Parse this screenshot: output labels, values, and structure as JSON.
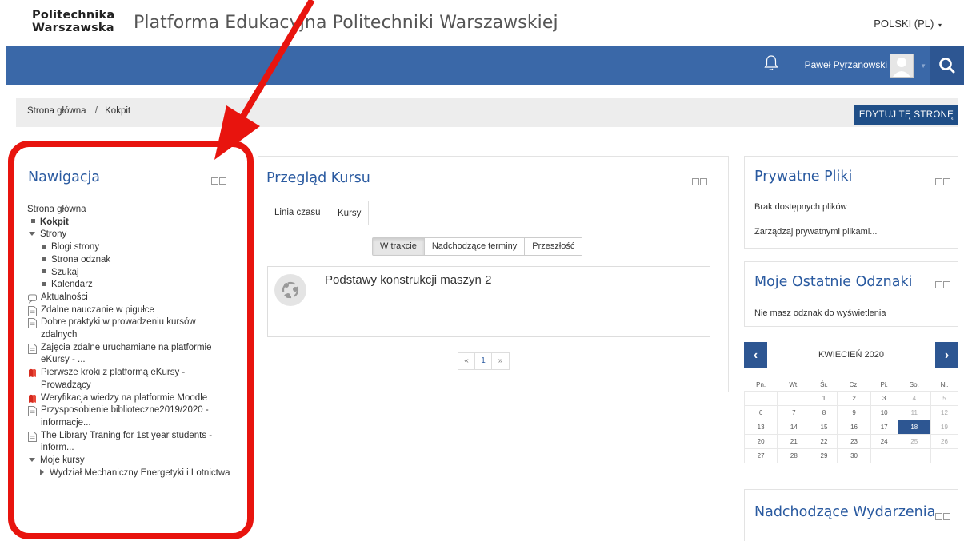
{
  "header": {
    "logo_line1": "Politechnika",
    "logo_line2": "Warszawska",
    "site_title": "Platforma Edukacyjna Politechniki Warszawskiej",
    "language": "POLSKI (PL)"
  },
  "navbar": {
    "user_name": "Paweł Pyrzanowski"
  },
  "breadcrumb": {
    "home": "Strona główna",
    "separator": "/",
    "current": "Kokpit",
    "edit_button": "EDYTUJ TĘ STRONĘ"
  },
  "navigation": {
    "title": "Nawigacja",
    "home": "Strona główna",
    "kokpit": "Kokpit",
    "strony": "Strony",
    "strony_items": [
      "Blogi strony",
      "Strona odznak",
      "Szukaj",
      "Kalendarz"
    ],
    "aktualnosci": "Aktualności",
    "docs": [
      {
        "line1": "Zdalne nauczanie w pigułce",
        "line2": "",
        "icon": "document-icon"
      },
      {
        "line1": "Dobre praktyki w prowadzeniu kursów",
        "line2": "zdalnych",
        "icon": "document-icon"
      },
      {
        "line1": "Zajęcia zdalne uruchamiane na platformie",
        "line2": "eKursy - ...",
        "icon": "document-icon"
      },
      {
        "line1": "Pierwsze kroki z platformą eKursy -",
        "line2": "Prowadzący",
        "icon": "pdf-icon"
      },
      {
        "line1": "Weryfikacja wiedzy na platformie Moodle",
        "line2": "",
        "icon": "pdf-icon"
      },
      {
        "line1": "Przysposobienie biblioteczne2019/2020 -",
        "line2": "informacje...",
        "icon": "document-icon"
      },
      {
        "line1": "The Library Traning for 1st year students -",
        "line2": "inform...",
        "icon": "document-icon"
      }
    ],
    "moje_kursy": "Moje kursy",
    "faculty": "Wydział Mechaniczny Energetyki i Lotnictwa"
  },
  "course_overview": {
    "title": "Przegląd Kursu",
    "tabs": [
      "Linia czasu",
      "Kursy"
    ],
    "active_tab": "Kursy",
    "filters": [
      "W trakcie",
      "Nadchodzące terminy",
      "Przeszłość"
    ],
    "active_filter": "W trakcie",
    "course_name": "Podstawy konstrukcji maszyn 2",
    "pager": {
      "prev": "«",
      "page": "1",
      "next": "»"
    }
  },
  "private_files": {
    "title": "Prywatne Pliki",
    "empty_text": "Brak dostępnych plików",
    "manage_link": "Zarządzaj prywatnymi plikami..."
  },
  "badges": {
    "title": "Moje Ostatnie Odznaki",
    "empty_text": "Nie masz odznak do wyświetlenia"
  },
  "calendar": {
    "month": "KWIECIEŃ 2020",
    "prev_label": "‹",
    "next_label": "›",
    "weekdays": [
      "Pn.",
      "Wt.",
      "Śr.",
      "Cz.",
      "Pi.",
      "So.",
      "Ni."
    ],
    "weeks": [
      [
        "",
        "",
        "1",
        "2",
        "3",
        "4",
        "5"
      ],
      [
        "6",
        "7",
        "8",
        "9",
        "10",
        "11",
        "12"
      ],
      [
        "13",
        "14",
        "15",
        "16",
        "17",
        "18",
        "19"
      ],
      [
        "20",
        "21",
        "22",
        "23",
        "24",
        "25",
        "26"
      ],
      [
        "27",
        "28",
        "29",
        "30",
        "",
        "",
        ""
      ]
    ],
    "today": "18"
  },
  "events": {
    "title": "Nadchodzące Wydarzenia"
  },
  "colors": {
    "navbar": "#3a68a8",
    "accent_dark": "#2d5692",
    "link_blue": "#2a5aa0",
    "annotation_red": "#e8140e"
  }
}
